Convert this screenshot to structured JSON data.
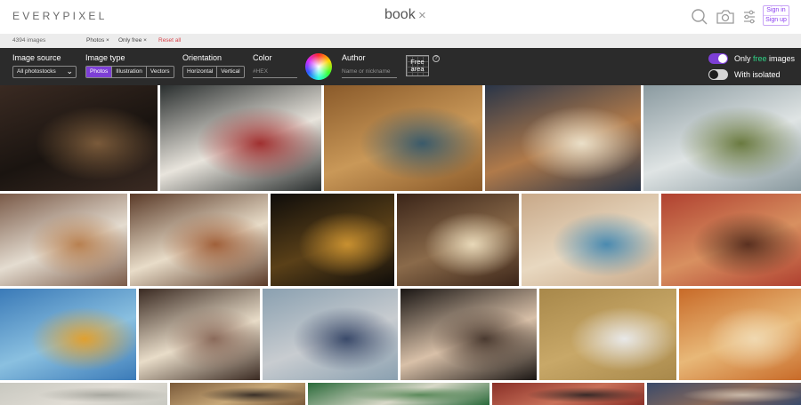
{
  "header": {
    "logo": "EVERYPIXEL",
    "query": "book",
    "clear_symbol": "×",
    "sign_in": "Sign in",
    "sign_up": "Sign up"
  },
  "summary": {
    "count": "4394 images",
    "chip_photos": "Photos ×",
    "chip_free": "Only free ×",
    "reset": "Reset all"
  },
  "filters": {
    "source_label": "Image source",
    "source_value": "All photostocks",
    "type_label": "Image type",
    "types": [
      "Photos",
      "Illustration",
      "Vectors"
    ],
    "orientation_label": "Orientation",
    "orientations": [
      "Horizontal",
      "Vertical"
    ],
    "color_label": "Color",
    "color_placeholder": "#HEX",
    "author_label": "Author",
    "author_placeholder": "Name or nickname",
    "free_area": "Free area",
    "help": "?",
    "only_free_prefix": "Only ",
    "only_free_highlight": "free",
    "only_free_suffix": " images",
    "only_free_on": true,
    "with_isolated": "With isolated",
    "with_isolated_on": false
  },
  "colors": {
    "accent": "#7d3fd6",
    "free_text": "#2fd487",
    "filter_bar": "#2b2b2b",
    "reset": "#d9434a"
  },
  "icons": [
    "search-icon",
    "camera-icon",
    "sliders-icon",
    "chevron-down-icon",
    "close-icon",
    "help-icon"
  ],
  "results": [
    {
      "subject": "bookshelf",
      "colors": [
        "#3a2a22",
        "#1a1410",
        "#7a5a3a"
      ]
    },
    {
      "subject": "laptop and notebook",
      "colors": [
        "#2a2f2f",
        "#e8e4dc",
        "#a03030"
      ]
    },
    {
      "subject": "library shelves",
      "colors": [
        "#8a5a2a",
        "#c99858",
        "#3a5a6a"
      ]
    },
    {
      "subject": "hands on bible",
      "colors": [
        "#2a3548",
        "#b07a4a",
        "#eadfc8"
      ]
    },
    {
      "subject": "plant and book",
      "colors": [
        "#8a9aa0",
        "#dfe4e4",
        "#6a7a40"
      ]
    },
    {
      "subject": "croissant and coffee",
      "colors": [
        "#7a5a48",
        "#e4dcd0",
        "#b88050"
      ]
    },
    {
      "subject": "piano and book",
      "colors": [
        "#5a3a28",
        "#e8dcc8",
        "#a0603a"
      ]
    },
    {
      "subject": "lamp and books",
      "colors": [
        "#0e0c0a",
        "#5a4018",
        "#c89030"
      ]
    },
    {
      "subject": "glasses on book",
      "colors": [
        "#3a2418",
        "#8a6a4a",
        "#e8d8b8"
      ]
    },
    {
      "subject": "desk from above",
      "colors": [
        "#c8a888",
        "#e8d8c0",
        "#4a8ab0"
      ]
    },
    {
      "subject": "coffee flask",
      "colors": [
        "#b04030",
        "#d89060",
        "#5a3020"
      ]
    },
    {
      "subject": "glass building",
      "colors": [
        "#3a7ab8",
        "#8ac0e0",
        "#e0a030"
      ]
    },
    {
      "subject": "open book",
      "colors": [
        "#3a2a22",
        "#e8dcc8",
        "#8a6a5a"
      ]
    },
    {
      "subject": "book on dock",
      "colors": [
        "#8aa0b0",
        "#c8ccd0",
        "#3a4a6a"
      ]
    },
    {
      "subject": "window desk",
      "colors": [
        "#1a1614",
        "#d8c0a8",
        "#4a3a30"
      ]
    },
    {
      "subject": "laptop on table",
      "colors": [
        "#a8884a",
        "#c8a868",
        "#e8e8e8"
      ]
    },
    {
      "subject": "pages close-up",
      "colors": [
        "#c86a28",
        "#e8b878",
        "#f0d8b0"
      ]
    },
    {
      "subject": "row four a",
      "colors": [
        "#c8c8c0",
        "#e0dcd4",
        "#a8a8a0"
      ]
    },
    {
      "subject": "row four b",
      "colors": [
        "#7a5a3a",
        "#c8a878",
        "#3a3028"
      ]
    },
    {
      "subject": "row four c",
      "colors": [
        "#2a6a3a",
        "#d8d8c8",
        "#5a8a5a"
      ]
    },
    {
      "subject": "row four d",
      "colors": [
        "#8a3028",
        "#c87058",
        "#3a2a28"
      ]
    },
    {
      "subject": "row four e",
      "colors": [
        "#3a4a6a",
        "#8a6a5a",
        "#c8b8a8"
      ]
    },
    {
      "subject": "row four f",
      "colors": [
        "#e8d8c8",
        "#c8a898",
        "#f0e8e0"
      ]
    }
  ]
}
